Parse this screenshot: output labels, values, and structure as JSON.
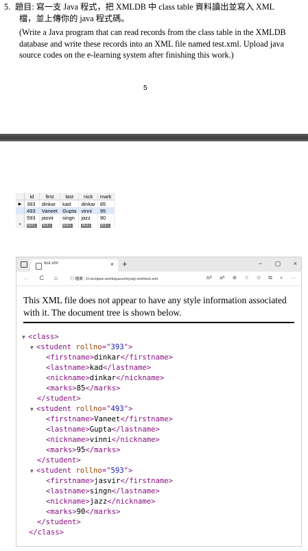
{
  "question": {
    "number": "5.",
    "zh_line1": "題目: 寫一支 Java 程式，把 XMLDB 中 class table 資料讀出並寫入 XML",
    "zh_line2": "檔，並上傳你的 java 程式碼。",
    "en_lines": [
      "(Write a Java program that can read records from the class table in the XMLDB",
      "database and write these records into an XML file named test.xml. Upload java",
      "source codes on the e-learning system after finishing this work.)"
    ]
  },
  "page_number": "5",
  "db_grid": {
    "columns": [
      "id",
      "first",
      "last",
      "nick",
      "mark"
    ],
    "rows": [
      [
        "393",
        "dinkar",
        "kad",
        "dinkar",
        "85"
      ],
      [
        "493",
        "Vaneet",
        "Gupta",
        "vinni",
        "95"
      ],
      [
        "593",
        "jasvir",
        "singn",
        "jazz",
        "90"
      ]
    ],
    "null_label": "NULL",
    "current_row_marker": "▶",
    "new_row_marker": "*"
  },
  "browser": {
    "tab_title": "test.xml",
    "tab_close": "×",
    "new_tab": "+",
    "window_buttons": [
      "−",
      "▢",
      "×"
    ],
    "nav": [
      "←",
      "C",
      "⌂"
    ],
    "url_info": "ⓘ 檔案",
    "url_path": "D:/eclipse-workspace/mysql-xml/test.xml",
    "tools": [
      "Aᴬ",
      "aᴬ",
      "⊕",
      "☆",
      "✩",
      "⧉",
      "●",
      "···"
    ],
    "notice": "This XML file does not appear to have any style information associated with it. The document tree is shown below."
  },
  "xml": {
    "root": "class",
    "attr_name": "rollno",
    "students": [
      {
        "rollno": "393",
        "firstname": "dinkar",
        "lastname": "kad",
        "nickname": "dinkar",
        "marks": "85"
      },
      {
        "rollno": "493",
        "firstname": "Vaneet",
        "lastname": "Gupta",
        "nickname": "vinni",
        "marks": "95"
      },
      {
        "rollno": "593",
        "firstname": "jasvir",
        "lastname": "singn",
        "nickname": "jazz",
        "marks": "90"
      }
    ],
    "toggle_glyph": "▼"
  }
}
